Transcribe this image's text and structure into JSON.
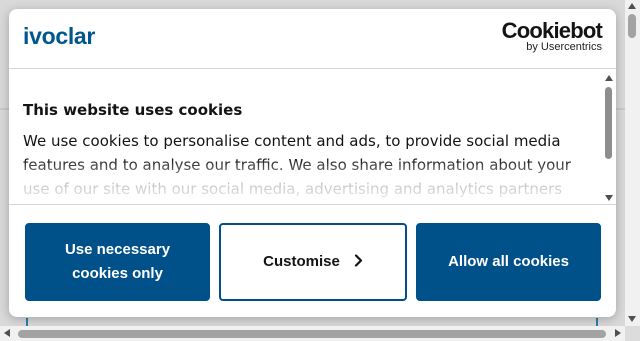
{
  "colors": {
    "brand": "#00508a",
    "logo": "#00568e",
    "text": "#141414"
  },
  "header": {
    "logo_text": "ivoclar",
    "cookiebot_logo": "Cookiebot",
    "cookiebot_sub": "by Usercentrics"
  },
  "content": {
    "title": "This website uses cookies",
    "body": "We use cookies to personalise content and ads, to provide social media features and to analyse our traffic. We also share information about your use of our site with our social media, advertising and analytics partners"
  },
  "buttons": {
    "necessary_line1": "Use necessary",
    "necessary_line2": "cookies only",
    "customise": "Customise",
    "allow_all": "Allow all cookies"
  },
  "icons": {
    "customise": "chevron-right-icon"
  }
}
